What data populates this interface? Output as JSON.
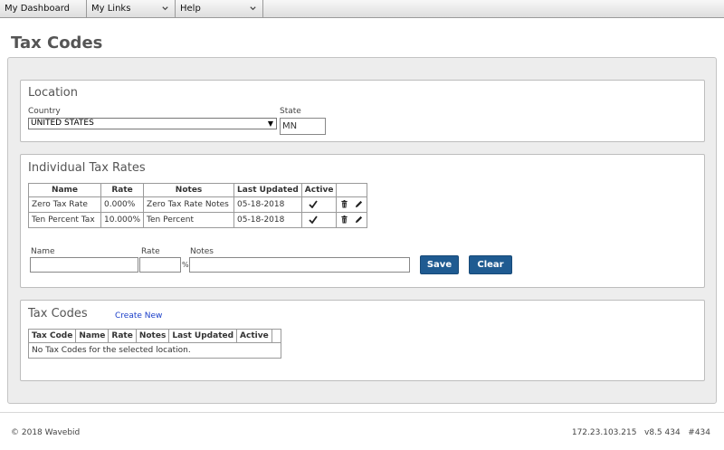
{
  "nav": {
    "items": [
      {
        "label": "My Dashboard"
      },
      {
        "label": "My Links"
      },
      {
        "label": "Help"
      }
    ]
  },
  "page": {
    "title": "Tax Codes"
  },
  "location": {
    "title": "Location",
    "country_label": "Country",
    "country_value": "UNITED STATES",
    "state_label": "State",
    "state_value": "MN"
  },
  "rates": {
    "title": "Individual Tax Rates",
    "columns": [
      "Name",
      "Rate",
      "Notes",
      "Last Updated",
      "Active"
    ],
    "rows": [
      {
        "name": "Zero Tax Rate",
        "rate": "0.000%",
        "notes": "Zero Tax Rate Notes",
        "updated": "05-18-2018",
        "active": true
      },
      {
        "name": "Ten Percent Tax",
        "rate": "10.000%",
        "notes": "Ten Percent",
        "updated": "05-18-2018",
        "active": true
      }
    ],
    "form": {
      "name_label": "Name",
      "rate_label": "Rate",
      "notes_label": "Notes",
      "percent_sign": "%",
      "name_value": "",
      "rate_value": "",
      "notes_value": "",
      "save_label": "Save",
      "clear_label": "Clear"
    }
  },
  "codes": {
    "title": "Tax Codes",
    "create_link": "Create New",
    "columns": [
      "Tax Code",
      "Name",
      "Rate",
      "Notes",
      "Last Updated",
      "Active"
    ],
    "empty_message": "No Tax Codes for the selected location."
  },
  "footer": {
    "copyright": "© 2018 Wavebid",
    "version": "172.23.103.215   v8.5 434   #434"
  },
  "colors": {
    "button": "#1f5b91",
    "link": "#1a3ec9",
    "panel_bg": "#ededed"
  },
  "icons": {
    "nav_dropdown": "chevron-down-icon",
    "active": "checkmark-icon",
    "delete": "trash-icon",
    "edit": "pencil-icon"
  }
}
